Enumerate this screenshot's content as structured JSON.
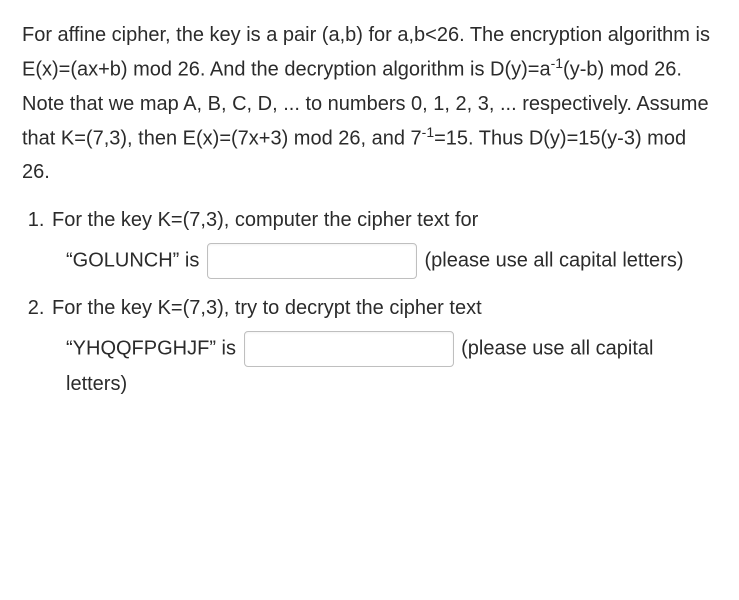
{
  "intro": {
    "line1": "For affine cipher, the key is a pair (a,b) for a,b<26. The encryption algorithm is E(x)=(ax+b) mod 26. And the decryption algorithm is D(y)=a",
    "sup1": "-1",
    "line1b": "(y-b) mod 26. Note that we map A, B, C, D, ... to numbers 0, 1, 2, 3, ... respectively. Assume that K=(7,3), then E(x)=(7x+3) mod 26, and 7",
    "sup2": "-1",
    "line1c": "=15. Thus D(y)=15(y-3) mod 26."
  },
  "q1": {
    "prompt": "For the key K=(7,3), computer the cipher text for",
    "pre": "“GOLUNCH” is",
    "post": "(please use all capital letters)",
    "value": ""
  },
  "q2": {
    "prompt": "For the key K=(7,3), try to decrypt the cipher text",
    "pre": "“YHQQFPGHJF” is",
    "post": "(please use all capital letters)",
    "value": ""
  }
}
